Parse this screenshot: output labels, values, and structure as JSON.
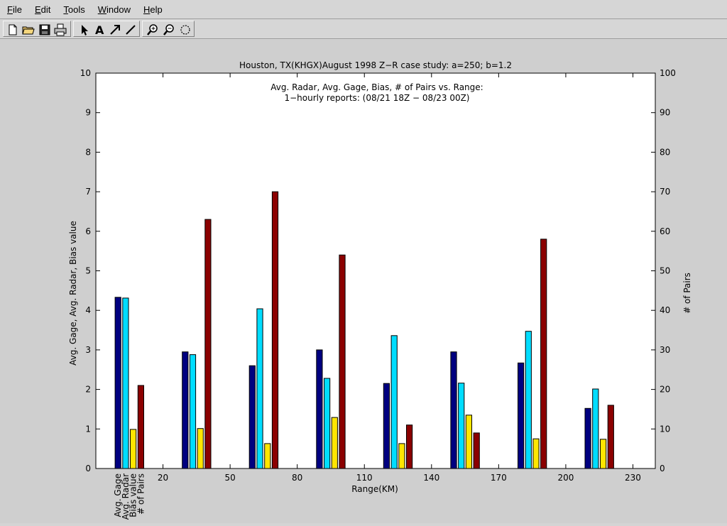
{
  "menu": [
    {
      "label": "File",
      "accel": "F",
      "rest": "ile"
    },
    {
      "label": "Edit",
      "accel": "E",
      "rest": "dit"
    },
    {
      "label": "Tools",
      "accel": "T",
      "rest": "ools"
    },
    {
      "label": "Window",
      "accel": "W",
      "rest": "indow"
    },
    {
      "label": "Help",
      "accel": "H",
      "rest": "elp"
    }
  ],
  "toolbar": {
    "icons": [
      "new-file-icon",
      "open-folder-icon",
      "save-icon",
      "print-icon",
      "select-arrow-icon",
      "text-insert-icon",
      "arrow-insert-icon",
      "line-insert-icon",
      "zoom-in-icon",
      "zoom-out-icon",
      "rotate-icon"
    ]
  },
  "chart_data": {
    "type": "bar",
    "title": "Houston, TX(KHGX)August 1998 Z−R case study: a=250; b=1.2",
    "inner_title_line1": "Avg. Radar, Avg. Gage, Bias, # of Pairs vs. Range:",
    "inner_title_line2": "1−hourly reports: (08/21 18Z − 08/23 00Z)",
    "xlabel": "Range(KM)",
    "ylabel_left": "Avg. Gage, Avg. Radar, Bias value",
    "ylabel_right": "# of Pairs",
    "xlim": [
      -10,
      240
    ],
    "ylim_left": [
      0,
      10
    ],
    "ylim_right": [
      0,
      100
    ],
    "x_ticks": [
      20,
      50,
      80,
      110,
      140,
      170,
      200,
      230
    ],
    "y_ticks_left": [
      0,
      1,
      2,
      3,
      4,
      5,
      6,
      7,
      8,
      9,
      10
    ],
    "y_ticks_right": [
      0,
      10,
      20,
      30,
      40,
      50,
      60,
      70,
      80,
      90,
      100
    ],
    "groups_x": [
      5,
      35,
      65,
      95,
      125,
      155,
      185,
      215
    ],
    "series": [
      {
        "name": "Avg. Gage",
        "axis": "left",
        "color": "#000080",
        "values": [
          4.33,
          2.95,
          2.6,
          3.0,
          2.15,
          2.95,
          2.67,
          1.52
        ]
      },
      {
        "name": "Avg. Radar",
        "axis": "left",
        "color": "#00ddff",
        "values": [
          4.31,
          2.88,
          4.04,
          2.28,
          3.36,
          2.16,
          3.47,
          2.01
        ]
      },
      {
        "name": "Bias value",
        "axis": "left",
        "color": "#ffe600",
        "values": [
          0.99,
          1.01,
          0.63,
          1.29,
          0.63,
          1.35,
          0.75,
          0.74
        ]
      },
      {
        "name": "# of Pairs",
        "axis": "right",
        "color": "#8b0000",
        "values": [
          21,
          63,
          70,
          54,
          11,
          9,
          58,
          16
        ]
      }
    ],
    "grid": false
  }
}
